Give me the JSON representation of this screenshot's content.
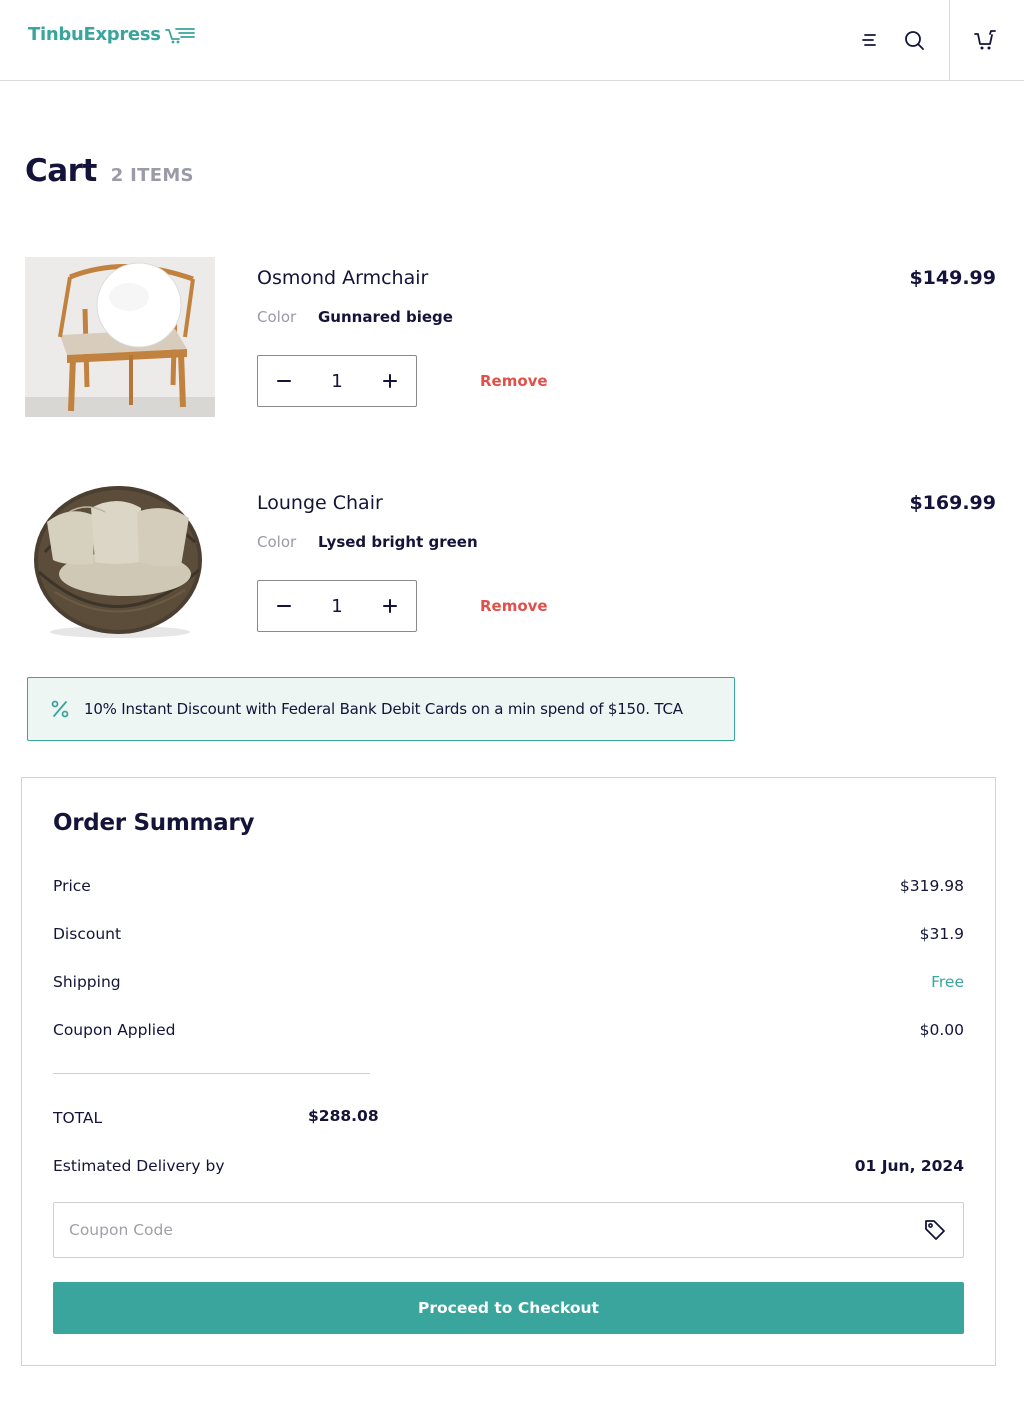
{
  "header": {
    "logo_text": "TinbuExpress",
    "logo_icon": "fast-cart-icon",
    "menu_icon": "menu-icon",
    "search_icon": "search-icon",
    "cart_icon": "cart-icon"
  },
  "page": {
    "title": "Cart",
    "item_count": "2 ITEMS"
  },
  "items": [
    {
      "name": "Osmond Armchair",
      "price": "$149.99",
      "color_label": "Color",
      "color_value": "Gunnared biege",
      "quantity": "1",
      "remove_label": "Remove",
      "image": "wooden-armchair-with-white-cushion"
    },
    {
      "name": "Lounge Chair",
      "price": "$169.99",
      "color_label": "Color",
      "color_value": "Lysed bright green",
      "quantity": "1",
      "remove_label": "Remove",
      "image": "wicker-round-lounge-chair"
    }
  ],
  "promo": {
    "icon": "percent-icon",
    "text": "10% Instant Discount with Federal Bank Debit Cards on a min spend of $150. TCA"
  },
  "summary": {
    "title": "Order Summary",
    "rows": [
      {
        "label": "Price",
        "value": "$319.98"
      },
      {
        "label": "Discount",
        "value": "$31.9"
      },
      {
        "label": "Shipping",
        "value": "Free"
      },
      {
        "label": "Coupon Applied",
        "value": "$0.00"
      }
    ],
    "total_label": "TOTAL",
    "total_value": "$288.08",
    "delivery_label": "Estimated Delivery by",
    "delivery_value": "01 Jun, 2024",
    "coupon_placeholder": "Coupon Code",
    "coupon_icon": "tag-icon",
    "checkout_label": "Proceed to Checkout"
  },
  "colors": {
    "accent": "#3aa59c",
    "remove": "#e0514b",
    "text": "#14143a",
    "muted": "#9a9aa8",
    "promo_bg": "#eef6f4"
  }
}
